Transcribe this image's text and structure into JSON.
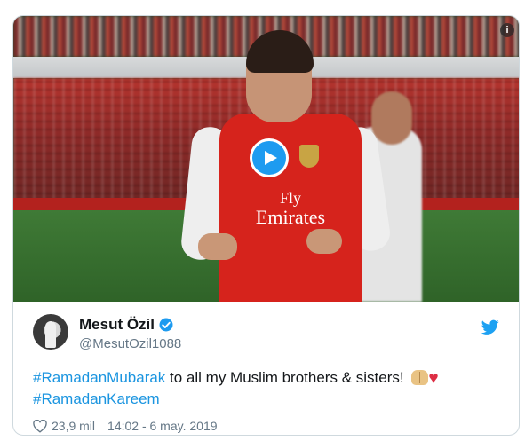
{
  "tweet": {
    "author": {
      "display_name": "Mesut Özil",
      "handle": "@MesutOzil1088",
      "verified": true
    },
    "text_parts": {
      "hashtag_1": "#RamadanMubarak",
      "body": " to all my Muslim brothers & sisters! ",
      "hashtag_2": "#RamadanKareem"
    },
    "emoji": [
      "folded-hands",
      "red-heart"
    ],
    "likes": "23,9 mil",
    "timestamp": "14:02 - 6 may. 2019"
  },
  "media": {
    "type": "video",
    "jersey_sponsor_line1": "Fly",
    "jersey_sponsor_line2": "Emirates",
    "info_label": "i"
  },
  "icons": [
    "play-icon",
    "info-icon",
    "verified-badge-icon",
    "twitter-bird-icon",
    "heart-outline-icon"
  ],
  "colors": {
    "accent": "#1d9bf0",
    "hashtag": "#1b95e0",
    "secondary_text": "#657786",
    "primary_text": "#14171a",
    "jersey_red": "#d6231c"
  }
}
